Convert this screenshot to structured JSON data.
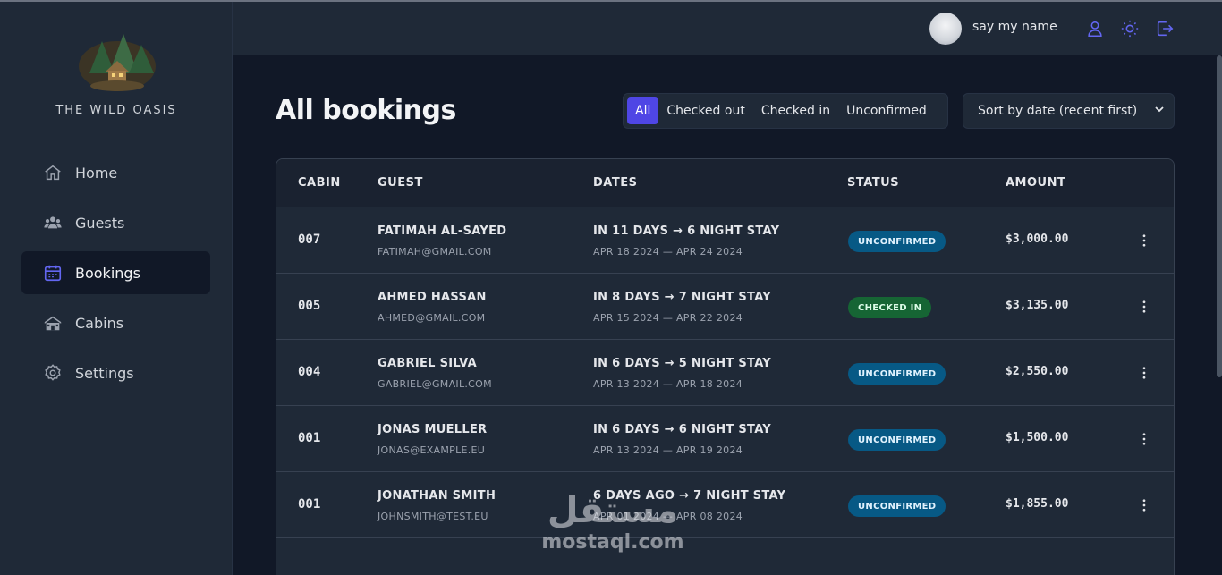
{
  "brand": {
    "name": "THE WILD OASIS"
  },
  "sidebar": {
    "items": [
      {
        "label": "Home",
        "icon": "home-icon"
      },
      {
        "label": "Guests",
        "icon": "users-icon"
      },
      {
        "label": "Bookings",
        "icon": "calendar-icon",
        "active": true
      },
      {
        "label": "Cabins",
        "icon": "cabin-icon"
      },
      {
        "label": "Settings",
        "icon": "gear-icon"
      }
    ]
  },
  "header": {
    "username": "say my name",
    "icons": [
      "user-icon",
      "sun-icon",
      "logout-icon"
    ]
  },
  "main": {
    "title": "All bookings",
    "filters": [
      "All",
      "Checked out",
      "Checked in",
      "Unconfirmed"
    ],
    "active_filter": "All",
    "sort": {
      "selected": "Sort by date (recent first)"
    }
  },
  "table": {
    "headers": [
      "CABIN",
      "GUEST",
      "DATES",
      "STATUS",
      "AMOUNT"
    ],
    "rows": [
      {
        "cabin": "007",
        "name": "FATIMAH AL-SAYED",
        "email": "FATIMAH@GMAIL.COM",
        "dates": "IN 11 DAYS → 6 NIGHT STAY",
        "range": "APR 18 2024 — APR 24 2024",
        "status": "UNCONFIRMED",
        "amount": "$3,000.00"
      },
      {
        "cabin": "005",
        "name": "AHMED HASSAN",
        "email": "AHMED@GMAIL.COM",
        "dates": "IN 8 DAYS → 7 NIGHT STAY",
        "range": "APR 15 2024 — APR 22 2024",
        "status": "CHECKED IN",
        "amount": "$3,135.00"
      },
      {
        "cabin": "004",
        "name": "GABRIEL SILVA",
        "email": "GABRIEL@GMAIL.COM",
        "dates": "IN 6 DAYS → 5 NIGHT STAY",
        "range": "APR 13 2024 — APR 18 2024",
        "status": "UNCONFIRMED",
        "amount": "$2,550.00"
      },
      {
        "cabin": "001",
        "name": "JONAS MUELLER",
        "email": "JONAS@EXAMPLE.EU",
        "dates": "IN 6 DAYS → 6 NIGHT STAY",
        "range": "APR 13 2024 — APR 19 2024",
        "status": "UNCONFIRMED",
        "amount": "$1,500.00"
      },
      {
        "cabin": "001",
        "name": "JONATHAN SMITH",
        "email": "JOHNSMITH@TEST.EU",
        "dates": "6 DAYS AGO → 7 NIGHT STAY",
        "range": "APR 01 2024 — APR 08 2024",
        "status": "UNCONFIRMED",
        "amount": "$1,855.00"
      }
    ]
  },
  "watermark": {
    "arabic": "مستقل",
    "latin": "mostaql.com"
  },
  "colors": {
    "accent": "#4f46e5",
    "unconfirmed": "#075985",
    "checked_in": "#166534"
  }
}
